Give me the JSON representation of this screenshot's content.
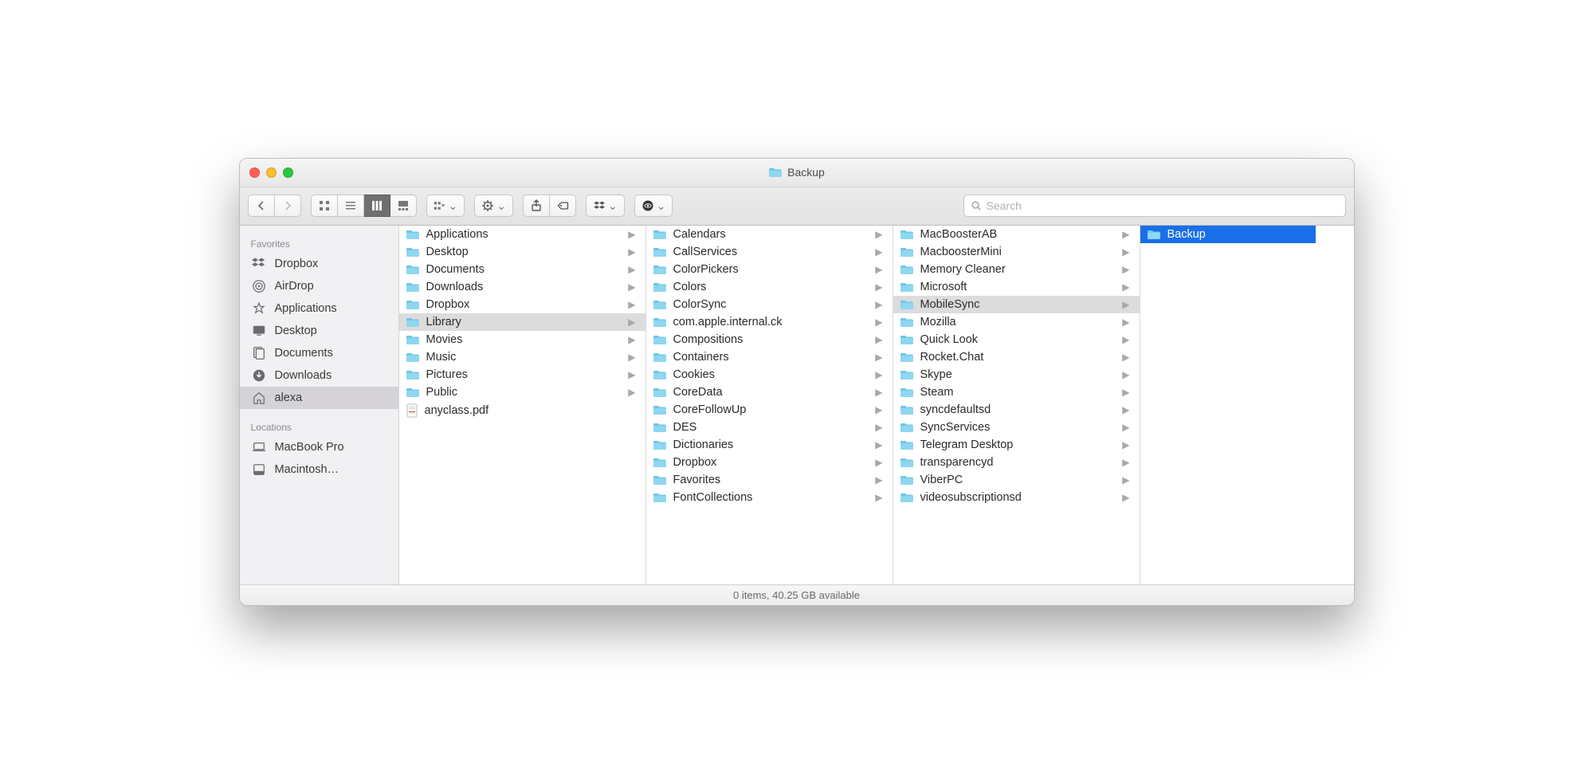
{
  "window": {
    "title": "Backup"
  },
  "toolbar": {
    "search_placeholder": "Search"
  },
  "sidebar": {
    "sections": [
      {
        "heading": "Favorites",
        "items": [
          {
            "label": "Dropbox",
            "icon": "dropbox",
            "selected": false
          },
          {
            "label": "AirDrop",
            "icon": "airdrop",
            "selected": false
          },
          {
            "label": "Applications",
            "icon": "applications",
            "selected": false
          },
          {
            "label": "Desktop",
            "icon": "desktop",
            "selected": false
          },
          {
            "label": "Documents",
            "icon": "documents",
            "selected": false
          },
          {
            "label": "Downloads",
            "icon": "downloads",
            "selected": false
          },
          {
            "label": "alexa",
            "icon": "home",
            "selected": true
          }
        ]
      },
      {
        "heading": "Locations",
        "items": [
          {
            "label": "MacBook Pro",
            "icon": "laptop",
            "selected": false
          },
          {
            "label": "Macintosh…",
            "icon": "disk",
            "selected": false
          }
        ]
      }
    ]
  },
  "columns": [
    {
      "selected": "Library",
      "items": [
        {
          "label": "Applications",
          "type": "folder",
          "hasChildren": true
        },
        {
          "label": "Desktop",
          "type": "folder",
          "hasChildren": true
        },
        {
          "label": "Documents",
          "type": "folder",
          "hasChildren": true
        },
        {
          "label": "Downloads",
          "type": "folder",
          "hasChildren": true
        },
        {
          "label": "Dropbox",
          "type": "folder",
          "hasChildren": true
        },
        {
          "label": "Library",
          "type": "folder",
          "hasChildren": true
        },
        {
          "label": "Movies",
          "type": "folder",
          "hasChildren": true
        },
        {
          "label": "Music",
          "type": "folder",
          "hasChildren": true
        },
        {
          "label": "Pictures",
          "type": "folder",
          "hasChildren": true
        },
        {
          "label": "Public",
          "type": "folder",
          "hasChildren": true
        },
        {
          "label": "anyclass.pdf",
          "type": "pdf",
          "hasChildren": false
        }
      ]
    },
    {
      "selected": null,
      "items": [
        {
          "label": "Calendars",
          "type": "folder",
          "hasChildren": true
        },
        {
          "label": "CallServices",
          "type": "folder",
          "hasChildren": true
        },
        {
          "label": "ColorPickers",
          "type": "folder",
          "hasChildren": true
        },
        {
          "label": "Colors",
          "type": "folder",
          "hasChildren": true
        },
        {
          "label": "ColorSync",
          "type": "folder",
          "hasChildren": true
        },
        {
          "label": "com.apple.internal.ck",
          "type": "folder",
          "hasChildren": true
        },
        {
          "label": "Compositions",
          "type": "folder",
          "hasChildren": true
        },
        {
          "label": "Containers",
          "type": "folder",
          "hasChildren": true
        },
        {
          "label": "Cookies",
          "type": "folder",
          "hasChildren": true
        },
        {
          "label": "CoreData",
          "type": "folder",
          "hasChildren": true
        },
        {
          "label": "CoreFollowUp",
          "type": "folder",
          "hasChildren": true
        },
        {
          "label": "DES",
          "type": "folder",
          "hasChildren": true
        },
        {
          "label": "Dictionaries",
          "type": "folder",
          "hasChildren": true
        },
        {
          "label": "Dropbox",
          "type": "folder",
          "hasChildren": true
        },
        {
          "label": "Favorites",
          "type": "folder",
          "hasChildren": true
        },
        {
          "label": "FontCollections",
          "type": "folder",
          "hasChildren": true
        }
      ]
    },
    {
      "selected": "MobileSync",
      "items": [
        {
          "label": "MacBoosterAB",
          "type": "folder",
          "hasChildren": true
        },
        {
          "label": "MacboosterMini",
          "type": "folder",
          "hasChildren": true
        },
        {
          "label": "Memory Cleaner",
          "type": "folder",
          "hasChildren": true
        },
        {
          "label": "Microsoft",
          "type": "folder",
          "hasChildren": true
        },
        {
          "label": "MobileSync",
          "type": "folder",
          "hasChildren": true
        },
        {
          "label": "Mozilla",
          "type": "folder",
          "hasChildren": true
        },
        {
          "label": "Quick Look",
          "type": "folder",
          "hasChildren": true
        },
        {
          "label": "Rocket.Chat",
          "type": "folder",
          "hasChildren": true
        },
        {
          "label": "Skype",
          "type": "folder",
          "hasChildren": true
        },
        {
          "label": "Steam",
          "type": "folder",
          "hasChildren": true
        },
        {
          "label": "syncdefaultsd",
          "type": "folder",
          "hasChildren": true
        },
        {
          "label": "SyncServices",
          "type": "folder",
          "hasChildren": true
        },
        {
          "label": "Telegram Desktop",
          "type": "folder",
          "hasChildren": true
        },
        {
          "label": "transparencyd",
          "type": "folder",
          "hasChildren": true
        },
        {
          "label": "ViberPC",
          "type": "folder",
          "hasChildren": true
        },
        {
          "label": "videosubscriptionsd",
          "type": "folder",
          "hasChildren": true
        }
      ]
    },
    {
      "selected": "Backup",
      "active": true,
      "items": [
        {
          "label": "Backup",
          "type": "folder",
          "hasChildren": false
        }
      ]
    }
  ],
  "status": {
    "text": "0 items, 40.25 GB available"
  }
}
